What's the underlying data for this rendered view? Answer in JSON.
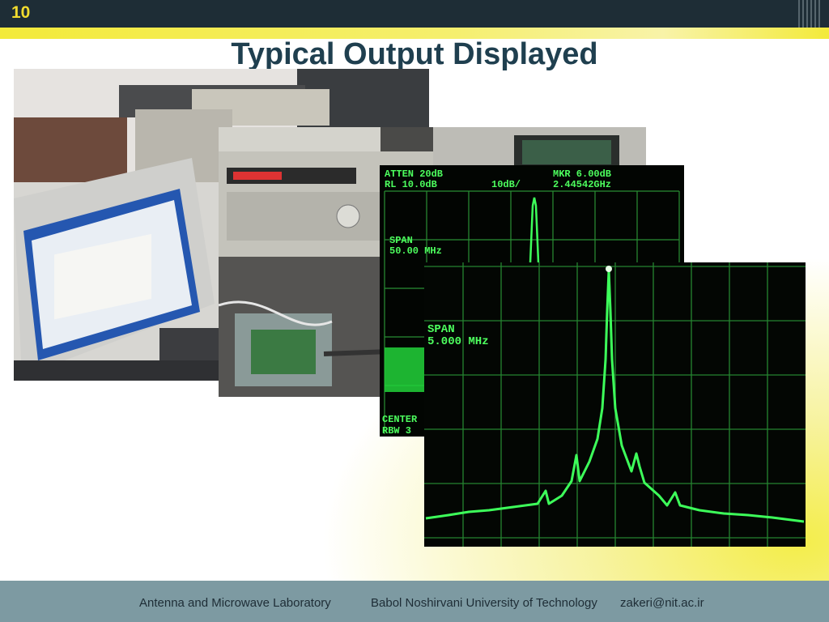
{
  "slide": {
    "number": "10",
    "title": "Typical Output Displayed"
  },
  "photos": {
    "lab": {
      "description": "Lab bench with LG monitor, signal generator and circuit board"
    },
    "analyzer1": {
      "atten": "ATTEN 20dB",
      "mkr": "MKR 6.00dB",
      "rl": "RL 10.0dB",
      "scale": "10dB/",
      "freq": "2.44542GHz",
      "span": "SPAN",
      "span_val": "50.00 MHz",
      "center": "CENTER",
      "rbw": "RBW 3"
    },
    "analyzer2": {
      "span": "SPAN",
      "span_val": "5.000 MHz"
    }
  },
  "footer": {
    "lab": "Antenna and Microwave Laboratory",
    "university": "Babol Noshirvani University of Technology",
    "email": "zakeri@nit.ac.ir"
  },
  "colors": {
    "topbar": "#1e2d36",
    "accent_yellow": "#f3ea3a",
    "title": "#1f3f4f",
    "footer": "#7d9aa2",
    "trace": "#3dff5a"
  }
}
